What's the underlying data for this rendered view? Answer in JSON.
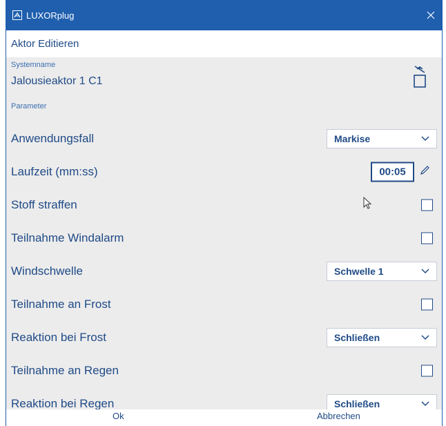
{
  "window": {
    "title": "LUXORplug",
    "accent_color": "#1f5fae",
    "icon": "app-logo-icon"
  },
  "dialog": {
    "header": "Aktor Editieren",
    "system_name_label": "Systemname",
    "system_name_value": "Jalousieaktor 1 C1",
    "delete_icon": "trash-icon",
    "parameter_label": "Parameter"
  },
  "params": [
    {
      "label": "Anwendungsfall",
      "type": "select",
      "value": "Markise"
    },
    {
      "label": "Laufzeit (mm:ss)",
      "type": "time",
      "value": "00:05"
    },
    {
      "label": "Stoff straffen",
      "type": "checkbox",
      "checked": false
    },
    {
      "label": "Teilnahme Windalarm",
      "type": "checkbox",
      "checked": false
    },
    {
      "label": "Windschwelle",
      "type": "select",
      "value": "Schwelle 1"
    },
    {
      "label": "Teilnahme an Frost",
      "type": "checkbox",
      "checked": false
    },
    {
      "label": "Reaktion bei Frost",
      "type": "select",
      "value": "Schließen"
    },
    {
      "label": "Teilnahme an Regen",
      "type": "checkbox",
      "checked": false
    },
    {
      "label": "Reaktion bei Regen",
      "type": "select",
      "value": "Schließen"
    }
  ],
  "footer": {
    "ok_label": "Ok",
    "cancel_label": "Abbrechen"
  }
}
